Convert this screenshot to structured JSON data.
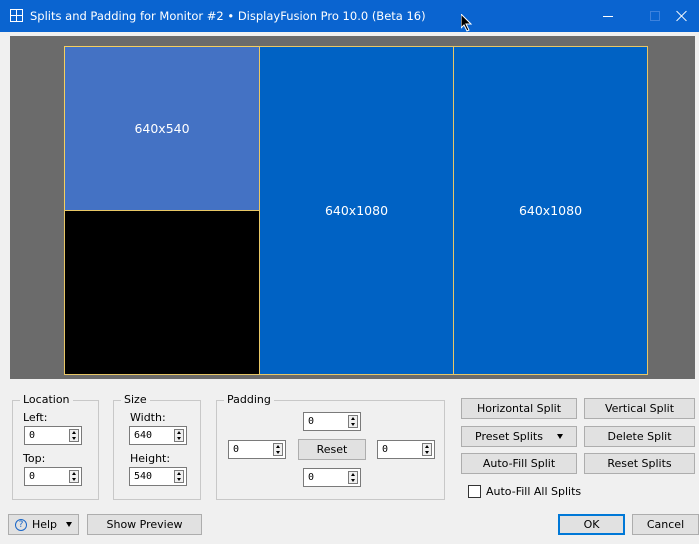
{
  "window": {
    "title": "Splits and Padding for Monitor #2 • DisplayFusion Pro 10.0 (Beta 16)"
  },
  "preview": {
    "splits": [
      {
        "label": "640x540"
      },
      {
        "label": ""
      },
      {
        "label": "640x1080"
      },
      {
        "label": "640x1080"
      }
    ]
  },
  "location": {
    "legend": "Location",
    "left_label": "Left:",
    "left_value": "0",
    "top_label": "Top:",
    "top_value": "0"
  },
  "size": {
    "legend": "Size",
    "width_label": "Width:",
    "width_value": "640",
    "height_label": "Height:",
    "height_value": "540"
  },
  "padding": {
    "legend": "Padding",
    "top_value": "0",
    "left_value": "0",
    "right_value": "0",
    "bottom_value": "0",
    "reset_label": "Reset"
  },
  "actions": {
    "horizontal_split": "Horizontal Split",
    "vertical_split": "Vertical Split",
    "preset_splits": "Preset Splits",
    "delete_split": "Delete Split",
    "auto_fill_split": "Auto-Fill Split",
    "reset_splits": "Reset Splits",
    "auto_fill_all_label": "Auto-Fill All Splits",
    "auto_fill_all_checked": false
  },
  "footer": {
    "help_label": "Help",
    "help_icon_glyph": "?",
    "show_preview_label": "Show Preview",
    "ok_label": "OK",
    "cancel_label": "Cancel"
  },
  "colors": {
    "titlebar": "#0a64d0",
    "split_selected": "#4472c4",
    "split": "#0062c4",
    "split_border": "#e8c766"
  }
}
